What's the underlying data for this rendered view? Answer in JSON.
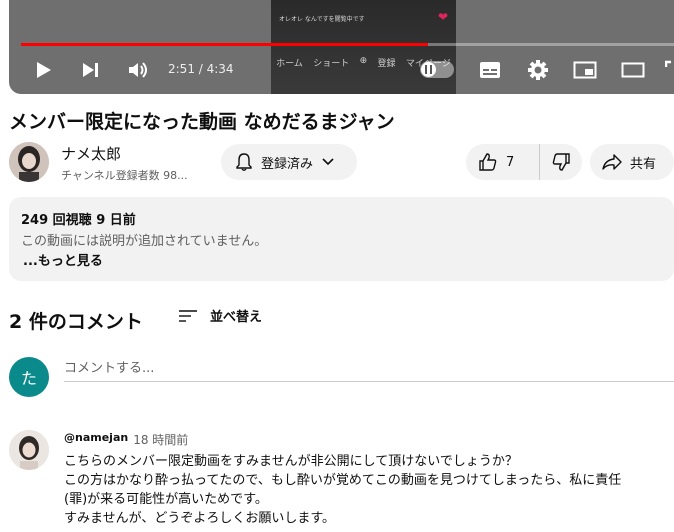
{
  "player": {
    "time": "2:51 / 4:34",
    "progress": 0.623,
    "overlay_text": "オレオレ なんですを閲覧中です",
    "overlay_nav": [
      "ホーム",
      "ショート",
      "",
      "登録",
      "マイページ"
    ]
  },
  "video": {
    "title": "メンバー限定になった動画 なめだるまジャン"
  },
  "channel": {
    "name": "ナメ太郎",
    "subscribers": "チャンネル登録者数 98..."
  },
  "actions": {
    "subscribe_label": "登録済み",
    "like_count": "7",
    "share_label": "共有"
  },
  "description": {
    "meta": "249 回視聴  9 日前",
    "body": "この動画には説明が追加されていません。",
    "more": "...もっと見る"
  },
  "comments": {
    "count_label": "2 件のコメント",
    "sort_label": "並べ替え",
    "input_placeholder": "コメントする...",
    "my_avatar_letter": "た",
    "items": [
      {
        "author": "@namejan",
        "time": "18 時間前",
        "lines": [
          "こちらのメンバー限定動画をすみませんが非公開にして頂けないでしょうか？",
          "この方はかなり酔っ払ってたので、もし酔いが覚めてこの動画を見つけてしまったら、私に責任",
          "(罪)が来る可能性が高いためです。",
          "すみませんが、どうぞよろしくお願いします。"
        ]
      }
    ]
  },
  "colors": {
    "progress": "#ff0000",
    "pill_bg": "#f2f2f2",
    "my_avatar": "#0a8a8a"
  }
}
